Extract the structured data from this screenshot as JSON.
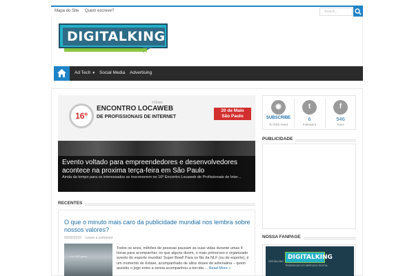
{
  "topbar": {
    "links": [
      "Mapa do Site",
      "Quem escreve?"
    ],
    "search_placeholder": "Search..."
  },
  "logo": {
    "text": "DIGITALKING"
  },
  "nav": {
    "items": [
      "Ad Tech",
      "Social Media",
      "Advertising"
    ]
  },
  "slider": {
    "hashtag": "#16elw",
    "badge": "16º",
    "event_title_1": "ENCONTRO LOCAWEB",
    "event_title_2": "DE PROFISSIONAIS DE INTERNET",
    "date_1": "20 de Maio",
    "date_2": "São Paulo",
    "title": "Evento voltado para empreendedores e desenvolvedores acontece na proxima terça-feira em São Paulo",
    "excerpt": "Ainda da tempo para os interessados se inscreverem no 16º Encontro Locaweb de Profissionais de Inter..."
  },
  "recentes": {
    "heading": "RECENTES",
    "post": {
      "title": "O que o minuto mais caro da publicidade mundial nos lembra sobre nossos valores?",
      "date": "03/02/2015",
      "comment": "Leave a comment",
      "thumb_text": "... it in 100 years",
      "excerpt": "Todos os anos, milhões de pessoas pausam as suas vidas durante umas 4 horas para acompanhar, os que alguns dizem, o mais primoroso e organizado evento do esporte mundial: Super Bowl! Para os fãs da NLF (ou do esporte), é um momento de êxtase, acompanhado de altos doses de adrenalina – quem assistiu o jogo entre a sereia acompanhou a torcida ...",
      "read_more": "Read More »"
    }
  },
  "social": [
    {
      "icon": "rss-icon",
      "glyph": "◉",
      "value": "SUBSCRIBE",
      "label": "To RSS Feed"
    },
    {
      "icon": "twitter-icon",
      "glyph": "t",
      "value": "6",
      "label": "Followers"
    },
    {
      "icon": "facebook-icon",
      "glyph": "f",
      "value": "546",
      "label": "Fans"
    }
  ],
  "publicidade": {
    "heading": "PUBLICIDADE"
  },
  "fanpage": {
    "heading": "NOSSA FANPAGE",
    "logo_text": "DIGITALKING",
    "tag": "DIGITALKING",
    "sub": "TENDENCIAS DO MERCADO DIGITAL"
  },
  "colors": {
    "accent": "#1e83c7",
    "nav_bg": "#2b2b2b",
    "link": "#1e6fa6",
    "brand_red": "#d32f2f"
  }
}
